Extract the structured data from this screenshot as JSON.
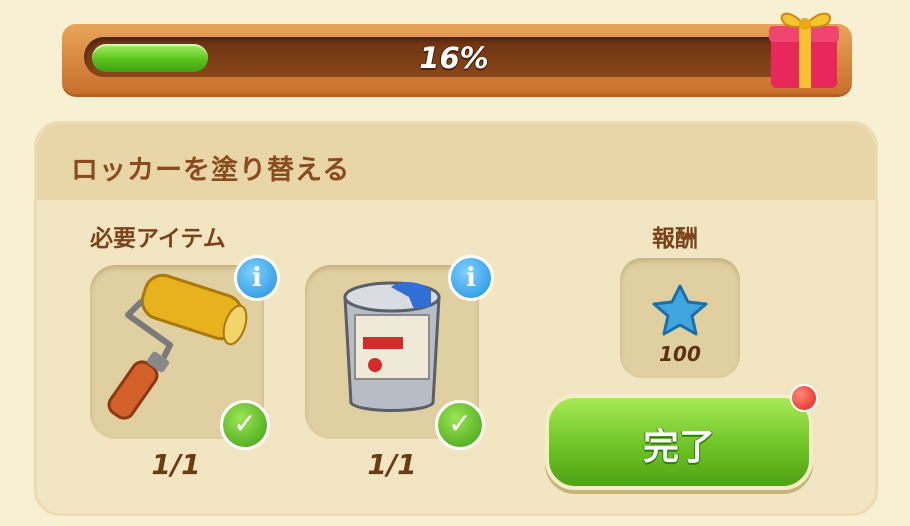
{
  "progress": {
    "percent": 16,
    "label": "16%"
  },
  "task": {
    "title": "ロッカーを塗り替える"
  },
  "requirements": {
    "label": "必要アイテム",
    "items": [
      {
        "name": "paint-roller",
        "count": "1/1"
      },
      {
        "name": "paint-can",
        "count": "1/1"
      }
    ]
  },
  "reward": {
    "label": "報酬",
    "icon": "blue-star-icon",
    "amount": "100"
  },
  "complete_button": {
    "label": "完了"
  },
  "icons": {
    "info": "i",
    "check": "✓"
  },
  "colors": {
    "progress_green": "#5bc41e",
    "button_green": "#6ec325",
    "info_blue": "#1f8fe0",
    "title_brown": "#8a4b1e"
  }
}
